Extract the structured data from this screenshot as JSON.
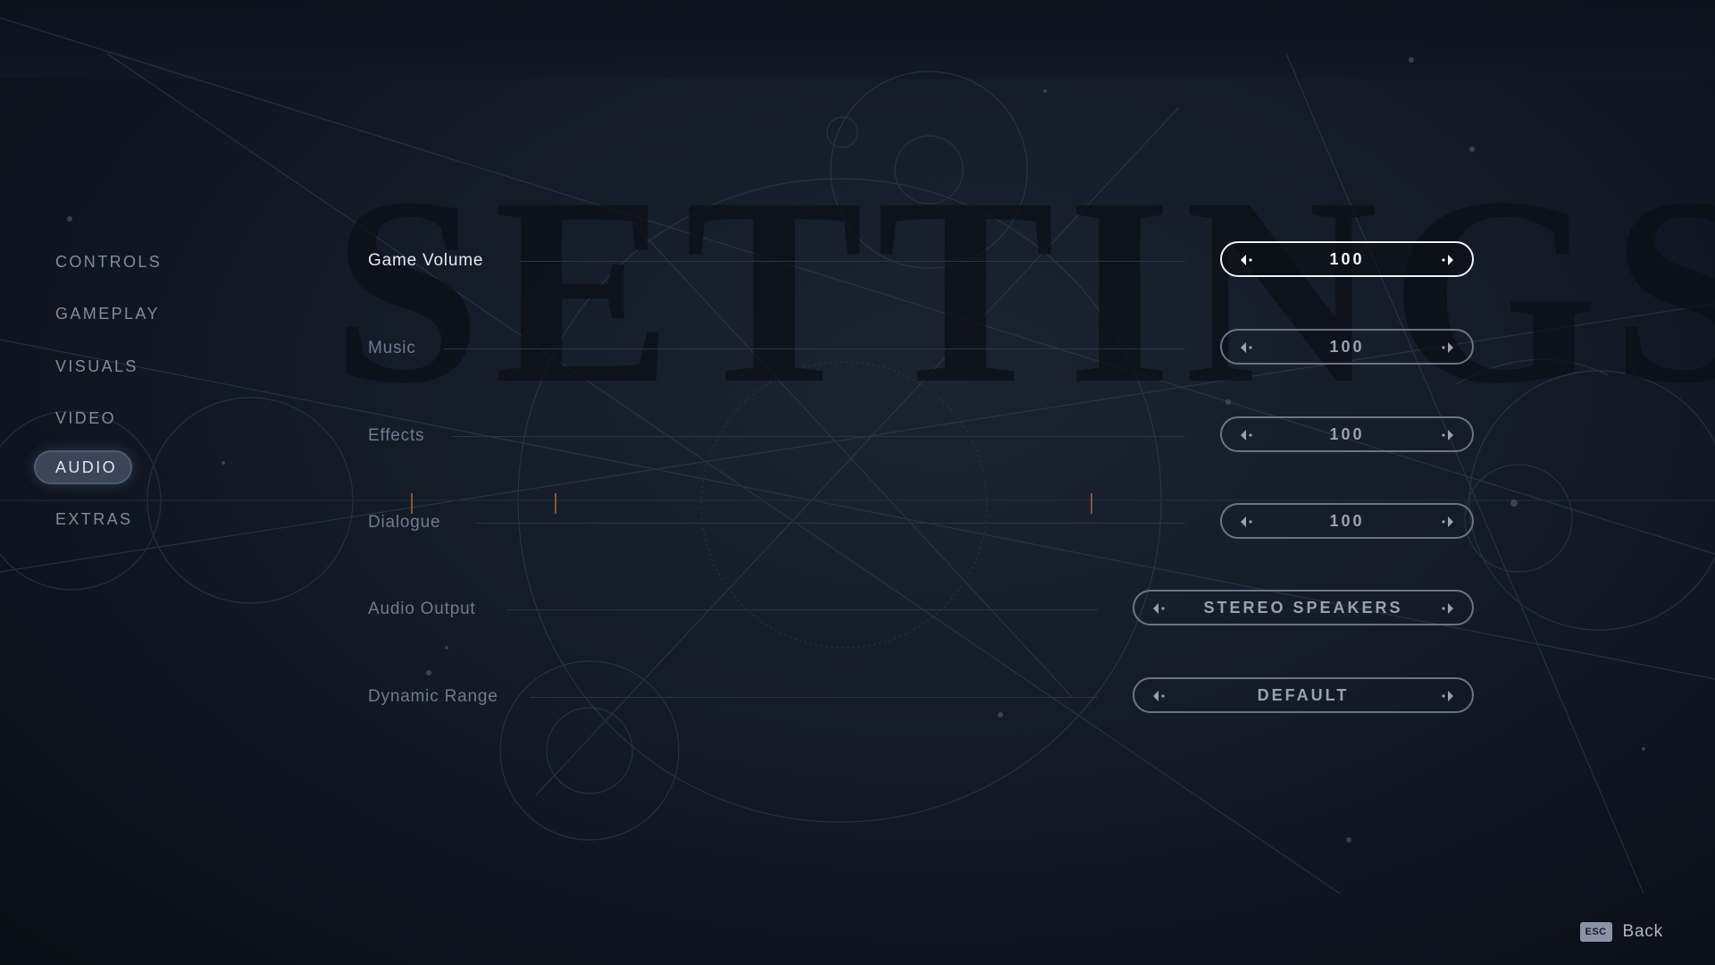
{
  "watermark": "SETTINGS",
  "sidebar": {
    "items": [
      {
        "label": "CONTROLS",
        "active": false
      },
      {
        "label": "GAMEPLAY",
        "active": false
      },
      {
        "label": "VISUALS",
        "active": false
      },
      {
        "label": "VIDEO",
        "active": false
      },
      {
        "label": "AUDIO",
        "active": true
      },
      {
        "label": "EXTRAS",
        "active": false
      }
    ]
  },
  "settings": {
    "rows": [
      {
        "label": "Game Volume",
        "value": "100",
        "active": true
      },
      {
        "label": "Music",
        "value": "100",
        "active": false
      },
      {
        "label": "Effects",
        "value": "100",
        "active": false
      },
      {
        "label": "Dialogue",
        "value": "100",
        "active": false
      },
      {
        "label": "Audio Output",
        "value": "STEREO SPEAKERS",
        "active": false
      },
      {
        "label": "Dynamic Range",
        "value": "DEFAULT",
        "active": false
      }
    ]
  },
  "footer": {
    "key": "ESC",
    "label": "Back"
  },
  "icons": {
    "arrow_left": "arrow-left-icon",
    "arrow_right": "arrow-right-icon"
  },
  "colors": {
    "background": "#141b27",
    "accent_line": "#a8633a",
    "active_text": "#e4e9f1",
    "inactive_text": "#6f7b90"
  }
}
